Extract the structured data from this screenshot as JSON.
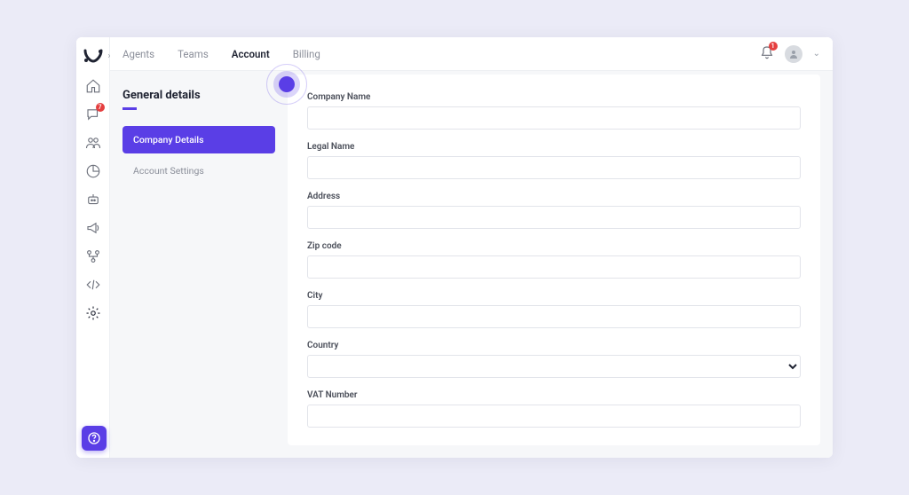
{
  "tabs": {
    "agents": "Agents",
    "teams": "Teams",
    "account": "Account",
    "billing": "Billing"
  },
  "header": {
    "title": "General details"
  },
  "sidenav": {
    "company_details": "Company Details",
    "account_settings": "Account Settings"
  },
  "fields": {
    "company_name": "Company Name",
    "legal_name": "Legal Name",
    "address": "Address",
    "zip_code": "Zip code",
    "city": "City",
    "country": "Country",
    "vat_number": "VAT Number"
  },
  "badges": {
    "rail_chat": "7",
    "bell": "1"
  },
  "icons": {
    "home": "home-icon",
    "chat": "chat-icon",
    "people": "people-icon",
    "pie": "pie-icon",
    "bot": "bot-icon",
    "megaphone": "megaphone-icon",
    "flow": "flow-icon",
    "code": "code-icon",
    "settings": "settings-icon",
    "bell": "bell-icon",
    "avatar": "avatar-icon",
    "help": "help-icon"
  }
}
